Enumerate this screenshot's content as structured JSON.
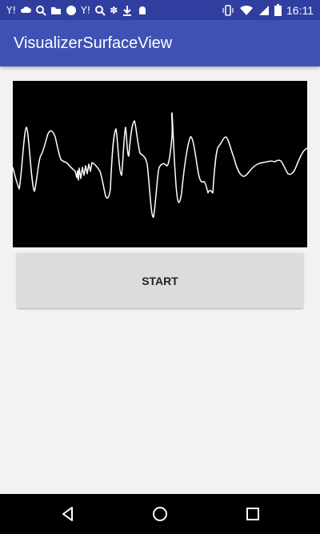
{
  "status_bar": {
    "time": "16:11",
    "left_icons": [
      "yahoo-icon",
      "cloud-icon",
      "search-icon",
      "folder-icon",
      "messenger-icon",
      "yahoo-icon",
      "search-icon",
      "gear-icon",
      "download-icon",
      "android-icon"
    ],
    "right_icons": [
      "vibrate-icon",
      "wifi-icon",
      "signal-icon",
      "battery-icon"
    ]
  },
  "app_bar": {
    "title": "VisualizerSurfaceView"
  },
  "visualizer": {
    "background": "#000000",
    "line_color": "#ffffff"
  },
  "start_button": {
    "label": "START"
  },
  "nav_bar": {
    "buttons": [
      "back-icon",
      "home-icon",
      "recents-icon"
    ]
  },
  "colors": {
    "status_bar": "#303f9f",
    "app_bar": "#3f51b5",
    "background": "#f2f2f2",
    "button": "#dcdcdc"
  }
}
